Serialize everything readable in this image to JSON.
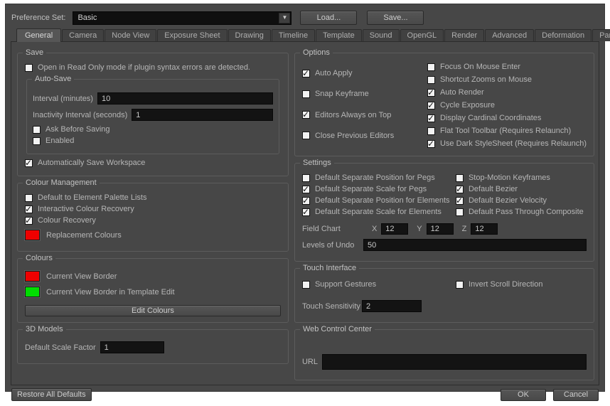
{
  "colors": {
    "replacement_swatch": "#ee0000",
    "current_view_border_swatch": "#ee0000",
    "template_edit_border_swatch": "#00dd00"
  },
  "header": {
    "preference_set_label": "Preference Set:",
    "preference_set_value": "Basic",
    "load_button": "Load...",
    "save_button": "Save..."
  },
  "tabs": {
    "active": "General",
    "items": [
      "General",
      "Camera",
      "Node View",
      "Exposure Sheet",
      "Drawing",
      "Timeline",
      "Template",
      "Sound",
      "OpenGL",
      "Render",
      "Advanced",
      "Deformation",
      "Particle"
    ]
  },
  "save": {
    "title": "Save",
    "open_read_only": {
      "label": "Open in Read Only mode if plugin syntax errors are detected.",
      "checked": false
    },
    "auto_save": {
      "title": "Auto-Save",
      "interval_label": "Interval (minutes)",
      "interval_value": "10",
      "inactivity_label": "Inactivity Interval (seconds)",
      "inactivity_value": "1",
      "ask_before_saving": {
        "label": "Ask Before Saving",
        "checked": false
      },
      "enabled": {
        "label": "Enabled",
        "checked": false
      }
    },
    "auto_save_workspace": {
      "label": "Automatically Save Workspace",
      "checked": true
    }
  },
  "colour_management": {
    "title": "Colour Management",
    "default_palette": {
      "label": "Default to Element Palette Lists",
      "checked": false
    },
    "interactive_recovery": {
      "label": "Interactive Colour Recovery",
      "checked": true
    },
    "colour_recovery": {
      "label": "Colour Recovery",
      "checked": true
    },
    "replacement_colours_label": "Replacement Colours"
  },
  "colours": {
    "title": "Colours",
    "current_view_border_label": "Current View Border",
    "template_edit_border_label": "Current View Border in Template Edit",
    "edit_colours_button": "Edit Colours"
  },
  "models3d": {
    "title": "3D Models",
    "scale_label": "Default Scale Factor",
    "scale_value": "1"
  },
  "options": {
    "title": "Options",
    "left": [
      {
        "label": "Auto Apply",
        "checked": true
      },
      {
        "label": "Snap Keyframe",
        "checked": false
      },
      {
        "label": "Editors Always on Top",
        "checked": true
      },
      {
        "label": "Close Previous Editors",
        "checked": false
      }
    ],
    "right": [
      {
        "label": "Focus On Mouse Enter",
        "checked": false
      },
      {
        "label": "Shortcut Zooms on Mouse",
        "checked": false
      },
      {
        "label": "Auto Render",
        "checked": true
      },
      {
        "label": "Cycle Exposure",
        "checked": true
      },
      {
        "label": "Display Cardinal Coordinates",
        "checked": true
      },
      {
        "label": "Flat Tool Toolbar (Requires Relaunch)",
        "checked": false
      },
      {
        "label": "Use Dark StyleSheet (Requires Relaunch)",
        "checked": true
      }
    ]
  },
  "settings": {
    "title": "Settings",
    "left": [
      {
        "label": "Default Separate Position for Pegs",
        "checked": false
      },
      {
        "label": "Default Separate Scale for Pegs",
        "checked": true
      },
      {
        "label": "Default Separate Position for Elements",
        "checked": true
      },
      {
        "label": "Default Separate Scale for Elements",
        "checked": true
      }
    ],
    "right": [
      {
        "label": "Stop-Motion Keyframes",
        "checked": false
      },
      {
        "label": "Default Bezier",
        "checked": true
      },
      {
        "label": "Default Bezier Velocity",
        "checked": true
      },
      {
        "label": "Default Pass Through Composite",
        "checked": false
      }
    ],
    "field_chart": {
      "label": "Field Chart",
      "x_label": "X",
      "x_value": "12",
      "y_label": "Y",
      "y_value": "12",
      "z_label": "Z",
      "z_value": "12"
    },
    "levels_of_undo": {
      "label": "Levels of Undo",
      "value": "50"
    }
  },
  "touch": {
    "title": "Touch Interface",
    "support_gestures": {
      "label": "Support Gestures",
      "checked": false
    },
    "invert_scroll": {
      "label": "Invert Scroll Direction",
      "checked": false
    },
    "sensitivity_label": "Touch Sensitivity",
    "sensitivity_value": "2"
  },
  "web_control": {
    "title": "Web Control Center",
    "url_label": "URL",
    "url_value": ""
  },
  "footer": {
    "restore_button": "Restore All Defaults",
    "ok_button": "OK",
    "cancel_button": "Cancel"
  }
}
